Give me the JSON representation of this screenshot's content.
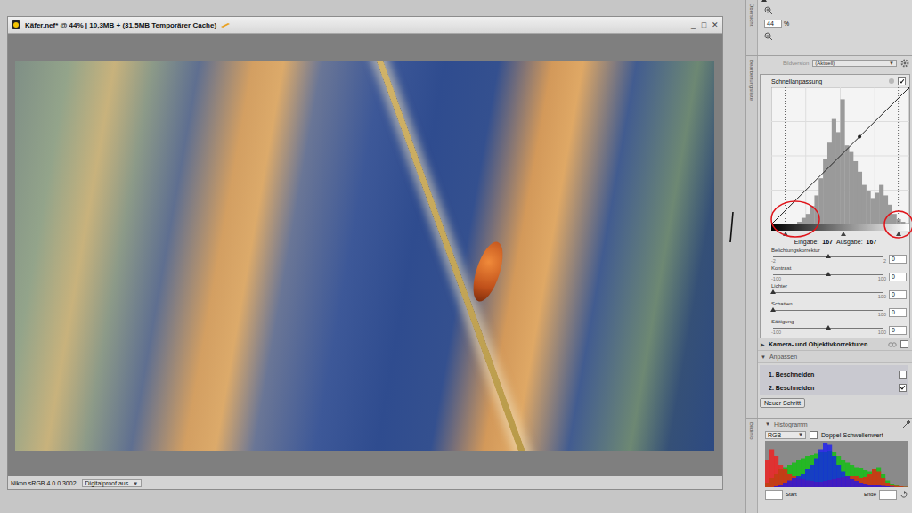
{
  "document_window": {
    "title": "Käfer.nef* @ 44% | 10,3MB + (31,5MB Temporärer Cache)",
    "controls": [
      "_",
      "□",
      "✕"
    ],
    "status_bar": {
      "profile": "Nikon sRGB 4.0.0.3002",
      "proof": "Digitalproof aus",
      "proof_arrow": "▼"
    }
  },
  "overview": {
    "tab": "Übersicht",
    "zoom": "44",
    "unit": "%"
  },
  "edit_list": {
    "tab": "Bearbeitungsliste",
    "version_label": "Bildversion",
    "version": "(Aktuell)",
    "version_arrow": "▼"
  },
  "quick_fix": {
    "title": "Schnellanpassung",
    "enabled": true,
    "curve_histogram": [
      0,
      0,
      0,
      0,
      0,
      0,
      2,
      5,
      8,
      14,
      22,
      35,
      50,
      62,
      80,
      70,
      95,
      60,
      55,
      48,
      40,
      30,
      25,
      20,
      24,
      30,
      22,
      15,
      8,
      4,
      2,
      1
    ],
    "curve_points": [
      [
        0,
        0
      ],
      [
        163,
        163
      ],
      [
        255,
        255
      ]
    ],
    "handles": [
      {
        "level": 0.1
      },
      {
        "level": 0.52
      },
      {
        "level": 0.92
      }
    ],
    "readout": {
      "input_label": "Eingabe:",
      "input": "167",
      "output_label": "Ausgabe:",
      "output": "167"
    },
    "sliders": [
      {
        "label": "Belichtungskorrektur",
        "min": "-2",
        "max": "2",
        "value": "0",
        "level": 0.5
      },
      {
        "label": "Kontrast",
        "min": "-100",
        "max": "100",
        "value": "0",
        "level": 0.5
      },
      {
        "label": "Lichter",
        "max": "100",
        "value": "0",
        "level": 0
      },
      {
        "label": "Schatten",
        "max": "100",
        "value": "0",
        "level": 0
      },
      {
        "label": "Sättigung",
        "min": "-100",
        "max": "100",
        "value": "0",
        "level": 0.5
      }
    ]
  },
  "camera_corrections": {
    "title": "Kamera- und Objektivkorrekturen",
    "arrow": "▶",
    "enabled": false
  },
  "adjust": {
    "title": "Anpassen",
    "arrow": "▼",
    "steps": [
      {
        "label": "1. Beschneiden",
        "checked": false
      },
      {
        "label": "2. Beschneiden",
        "checked": true
      }
    ],
    "new_step": "Neuer Schritt"
  },
  "histogram": {
    "tab": "Bildinfo",
    "title": "Histogramm",
    "arrow": "▼",
    "channel": "RGB",
    "channel_arrow": "▼",
    "dual_threshold_label": "Doppel-Schwellenwert",
    "dual_threshold": false,
    "series": [
      {
        "name": "green",
        "color": "#00c800",
        "values": [
          10,
          20,
          30,
          40,
          45,
          50,
          55,
          60,
          65,
          70,
          72,
          75,
          78,
          80,
          82,
          78,
          70,
          60,
          55,
          50,
          45,
          42,
          38,
          35,
          40,
          45,
          30,
          15,
          8,
          4,
          2,
          1
        ]
      },
      {
        "name": "red",
        "color": "#ff1010",
        "values": [
          60,
          85,
          70,
          50,
          40,
          30,
          25,
          20,
          18,
          15,
          14,
          12,
          12,
          14,
          16,
          18,
          20,
          22,
          24,
          26,
          24,
          20,
          22,
          30,
          40,
          35,
          20,
          10,
          5,
          3,
          2,
          1
        ]
      },
      {
        "name": "blue",
        "color": "#1010ff",
        "values": [
          0,
          0,
          2,
          5,
          10,
          15,
          20,
          25,
          30,
          40,
          50,
          65,
          85,
          100,
          95,
          70,
          50,
          35,
          25,
          18,
          14,
          10,
          8,
          6,
          5,
          4,
          3,
          2,
          1,
          0,
          0,
          0
        ]
      }
    ],
    "start_label": "Start",
    "end_label": "Ende"
  }
}
